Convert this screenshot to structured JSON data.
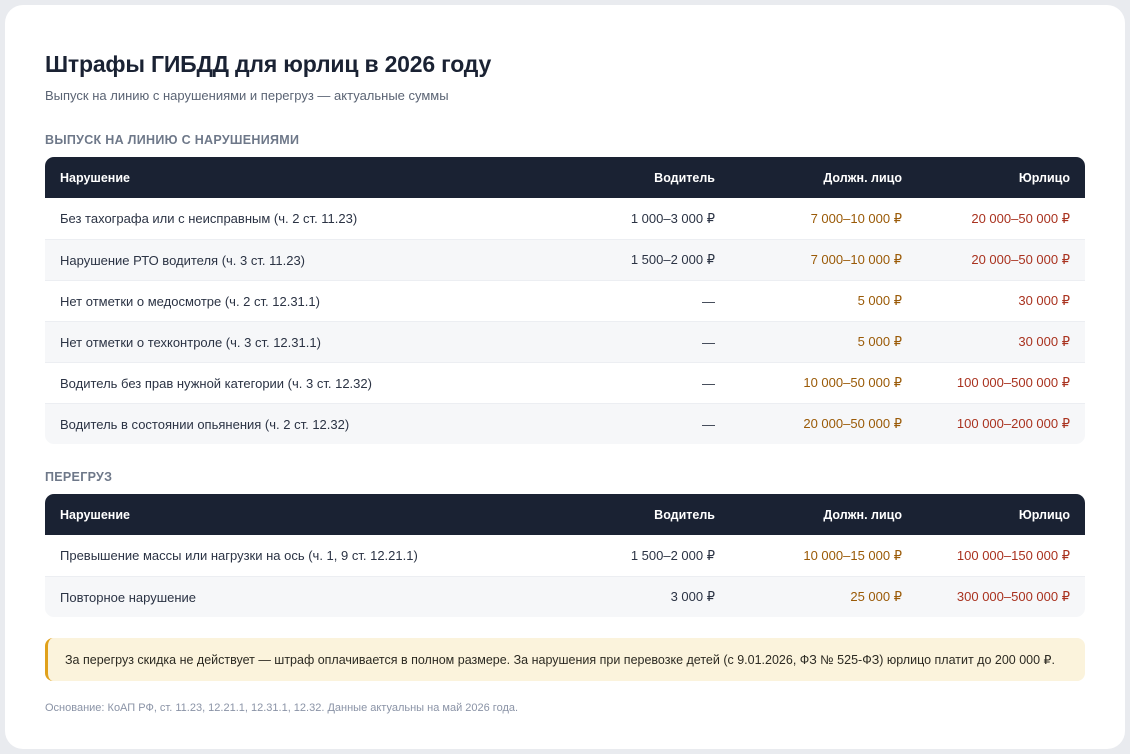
{
  "page": {
    "title": "Штрафы ГИБДД для юрлиц в 2026 году",
    "subtitle": "Выпуск на линию с нарушениями и перегруз — актуальные суммы"
  },
  "columns": {
    "violation": "Нарушение",
    "driver": "Водитель",
    "official": "Должн. лицо",
    "company": "Юрлицо"
  },
  "sections": [
    {
      "label": "ВЫПУСК НА ЛИНИЮ С НАРУШЕНИЯМИ",
      "rows": [
        {
          "violation": "Без тахографа или с неисправным (ч. 2 ст. 11.23)",
          "driver": "1 000–3 000 ₽",
          "official": "7 000–10 000 ₽",
          "company": "20 000–50 000 ₽"
        },
        {
          "violation": "Нарушение РТО водителя (ч. 3 ст. 11.23)",
          "driver": "1 500–2 000 ₽",
          "official": "7 000–10 000 ₽",
          "company": "20 000–50 000 ₽"
        },
        {
          "violation": "Нет отметки о медосмотре (ч. 2 ст. 12.31.1)",
          "driver": "—",
          "official": "5 000 ₽",
          "company": "30 000 ₽"
        },
        {
          "violation": "Нет отметки о техконтроле (ч. 3 ст. 12.31.1)",
          "driver": "—",
          "official": "5 000 ₽",
          "company": "30 000 ₽"
        },
        {
          "violation": "Водитель без прав нужной категории (ч. 3 ст. 12.32)",
          "driver": "—",
          "official": "10 000–50 000 ₽",
          "company": "100 000–500 000 ₽"
        },
        {
          "violation": "Водитель в состоянии опьянения (ч. 2 ст. 12.32)",
          "driver": "—",
          "official": "20 000–50 000 ₽",
          "company": "100 000–200 000 ₽"
        }
      ]
    },
    {
      "label": "ПЕРЕГРУЗ",
      "rows": [
        {
          "violation": "Превышение массы или нагрузки на ось (ч. 1, 9 ст. 12.21.1)",
          "driver": "1 500–2 000 ₽",
          "official": "10 000–15 000 ₽",
          "company": "100 000–150 000 ₽"
        },
        {
          "violation": "Повторное нарушение",
          "driver": "3 000 ₽",
          "official": "25 000 ₽",
          "company": "300 000–500 000 ₽"
        }
      ]
    }
  ],
  "note": "За перегруз скидка не действует — штраф оплачивается в полном размере. За нарушения при перевозке детей (с 9.01.2026, ФЗ № 525-ФЗ) юрлицо платит до 200 000 ₽.",
  "source": "Основание: КоАП РФ, ст. 11.23, 12.21.1, 12.31.1, 12.32. Данные актуальны на май 2026 года.",
  "colors": {
    "header_bg": "#1a2233",
    "official_amount": "#9a5a07",
    "company_amount": "#a9321f",
    "note_bg": "#fbf3dc",
    "note_accent": "#e0a11b"
  }
}
